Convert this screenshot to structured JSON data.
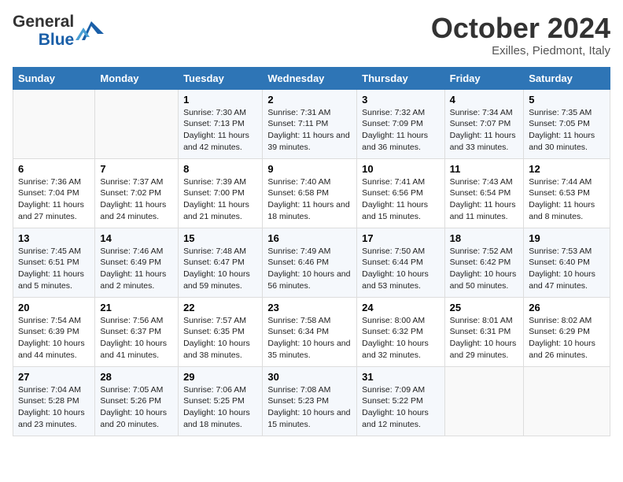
{
  "header": {
    "logo_line1": "General",
    "logo_line2": "Blue",
    "month_title": "October 2024",
    "location": "Exilles, Piedmont, Italy"
  },
  "days_of_week": [
    "Sunday",
    "Monday",
    "Tuesday",
    "Wednesday",
    "Thursday",
    "Friday",
    "Saturday"
  ],
  "weeks": [
    [
      {
        "day": "",
        "sunrise": "",
        "sunset": "",
        "daylight": ""
      },
      {
        "day": "",
        "sunrise": "",
        "sunset": "",
        "daylight": ""
      },
      {
        "day": "1",
        "sunrise": "Sunrise: 7:30 AM",
        "sunset": "Sunset: 7:13 PM",
        "daylight": "Daylight: 11 hours and 42 minutes."
      },
      {
        "day": "2",
        "sunrise": "Sunrise: 7:31 AM",
        "sunset": "Sunset: 7:11 PM",
        "daylight": "Daylight: 11 hours and 39 minutes."
      },
      {
        "day": "3",
        "sunrise": "Sunrise: 7:32 AM",
        "sunset": "Sunset: 7:09 PM",
        "daylight": "Daylight: 11 hours and 36 minutes."
      },
      {
        "day": "4",
        "sunrise": "Sunrise: 7:34 AM",
        "sunset": "Sunset: 7:07 PM",
        "daylight": "Daylight: 11 hours and 33 minutes."
      },
      {
        "day": "5",
        "sunrise": "Sunrise: 7:35 AM",
        "sunset": "Sunset: 7:05 PM",
        "daylight": "Daylight: 11 hours and 30 minutes."
      }
    ],
    [
      {
        "day": "6",
        "sunrise": "Sunrise: 7:36 AM",
        "sunset": "Sunset: 7:04 PM",
        "daylight": "Daylight: 11 hours and 27 minutes."
      },
      {
        "day": "7",
        "sunrise": "Sunrise: 7:37 AM",
        "sunset": "Sunset: 7:02 PM",
        "daylight": "Daylight: 11 hours and 24 minutes."
      },
      {
        "day": "8",
        "sunrise": "Sunrise: 7:39 AM",
        "sunset": "Sunset: 7:00 PM",
        "daylight": "Daylight: 11 hours and 21 minutes."
      },
      {
        "day": "9",
        "sunrise": "Sunrise: 7:40 AM",
        "sunset": "Sunset: 6:58 PM",
        "daylight": "Daylight: 11 hours and 18 minutes."
      },
      {
        "day": "10",
        "sunrise": "Sunrise: 7:41 AM",
        "sunset": "Sunset: 6:56 PM",
        "daylight": "Daylight: 11 hours and 15 minutes."
      },
      {
        "day": "11",
        "sunrise": "Sunrise: 7:43 AM",
        "sunset": "Sunset: 6:54 PM",
        "daylight": "Daylight: 11 hours and 11 minutes."
      },
      {
        "day": "12",
        "sunrise": "Sunrise: 7:44 AM",
        "sunset": "Sunset: 6:53 PM",
        "daylight": "Daylight: 11 hours and 8 minutes."
      }
    ],
    [
      {
        "day": "13",
        "sunrise": "Sunrise: 7:45 AM",
        "sunset": "Sunset: 6:51 PM",
        "daylight": "Daylight: 11 hours and 5 minutes."
      },
      {
        "day": "14",
        "sunrise": "Sunrise: 7:46 AM",
        "sunset": "Sunset: 6:49 PM",
        "daylight": "Daylight: 11 hours and 2 minutes."
      },
      {
        "day": "15",
        "sunrise": "Sunrise: 7:48 AM",
        "sunset": "Sunset: 6:47 PM",
        "daylight": "Daylight: 10 hours and 59 minutes."
      },
      {
        "day": "16",
        "sunrise": "Sunrise: 7:49 AM",
        "sunset": "Sunset: 6:46 PM",
        "daylight": "Daylight: 10 hours and 56 minutes."
      },
      {
        "day": "17",
        "sunrise": "Sunrise: 7:50 AM",
        "sunset": "Sunset: 6:44 PM",
        "daylight": "Daylight: 10 hours and 53 minutes."
      },
      {
        "day": "18",
        "sunrise": "Sunrise: 7:52 AM",
        "sunset": "Sunset: 6:42 PM",
        "daylight": "Daylight: 10 hours and 50 minutes."
      },
      {
        "day": "19",
        "sunrise": "Sunrise: 7:53 AM",
        "sunset": "Sunset: 6:40 PM",
        "daylight": "Daylight: 10 hours and 47 minutes."
      }
    ],
    [
      {
        "day": "20",
        "sunrise": "Sunrise: 7:54 AM",
        "sunset": "Sunset: 6:39 PM",
        "daylight": "Daylight: 10 hours and 44 minutes."
      },
      {
        "day": "21",
        "sunrise": "Sunrise: 7:56 AM",
        "sunset": "Sunset: 6:37 PM",
        "daylight": "Daylight: 10 hours and 41 minutes."
      },
      {
        "day": "22",
        "sunrise": "Sunrise: 7:57 AM",
        "sunset": "Sunset: 6:35 PM",
        "daylight": "Daylight: 10 hours and 38 minutes."
      },
      {
        "day": "23",
        "sunrise": "Sunrise: 7:58 AM",
        "sunset": "Sunset: 6:34 PM",
        "daylight": "Daylight: 10 hours and 35 minutes."
      },
      {
        "day": "24",
        "sunrise": "Sunrise: 8:00 AM",
        "sunset": "Sunset: 6:32 PM",
        "daylight": "Daylight: 10 hours and 32 minutes."
      },
      {
        "day": "25",
        "sunrise": "Sunrise: 8:01 AM",
        "sunset": "Sunset: 6:31 PM",
        "daylight": "Daylight: 10 hours and 29 minutes."
      },
      {
        "day": "26",
        "sunrise": "Sunrise: 8:02 AM",
        "sunset": "Sunset: 6:29 PM",
        "daylight": "Daylight: 10 hours and 26 minutes."
      }
    ],
    [
      {
        "day": "27",
        "sunrise": "Sunrise: 7:04 AM",
        "sunset": "Sunset: 5:28 PM",
        "daylight": "Daylight: 10 hours and 23 minutes."
      },
      {
        "day": "28",
        "sunrise": "Sunrise: 7:05 AM",
        "sunset": "Sunset: 5:26 PM",
        "daylight": "Daylight: 10 hours and 20 minutes."
      },
      {
        "day": "29",
        "sunrise": "Sunrise: 7:06 AM",
        "sunset": "Sunset: 5:25 PM",
        "daylight": "Daylight: 10 hours and 18 minutes."
      },
      {
        "day": "30",
        "sunrise": "Sunrise: 7:08 AM",
        "sunset": "Sunset: 5:23 PM",
        "daylight": "Daylight: 10 hours and 15 minutes."
      },
      {
        "day": "31",
        "sunrise": "Sunrise: 7:09 AM",
        "sunset": "Sunset: 5:22 PM",
        "daylight": "Daylight: 10 hours and 12 minutes."
      },
      {
        "day": "",
        "sunrise": "",
        "sunset": "",
        "daylight": ""
      },
      {
        "day": "",
        "sunrise": "",
        "sunset": "",
        "daylight": ""
      }
    ]
  ]
}
